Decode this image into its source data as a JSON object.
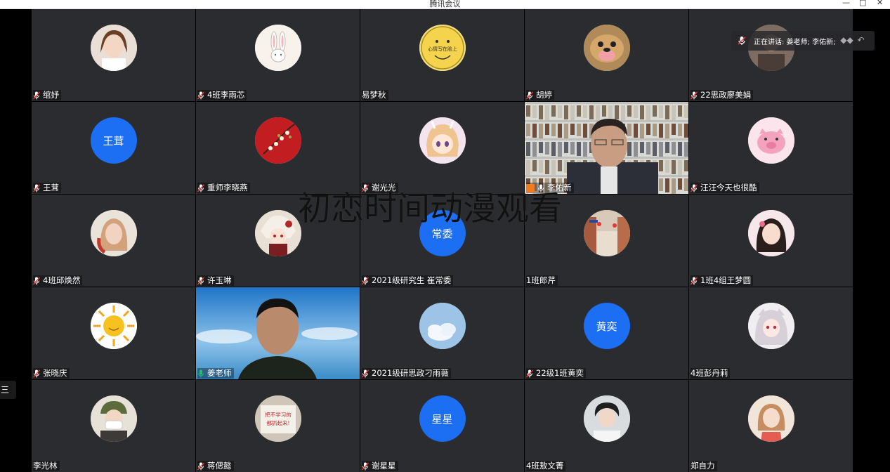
{
  "window": {
    "title": "腾讯会议",
    "min": "—",
    "max": "□",
    "close": "✕"
  },
  "speaking": {
    "text": "正在讲话: 姜老师; 李佑新;"
  },
  "watermark": "初恋时间动漫观看",
  "left_tab": "三",
  "accent": "#1c6ef3",
  "active_speaker_color": "#1fc16b",
  "tiles": [
    {
      "name": "绾妤",
      "mic": "muted",
      "avatar": "photo",
      "art": "girl"
    },
    {
      "name": "4班李雨芯",
      "mic": "muted",
      "avatar": "photo",
      "art": "rabbit"
    },
    {
      "name": "易梦秋",
      "mic": "none",
      "avatar": "photo",
      "art": "smiley",
      "art_text": "心情写在脸上"
    },
    {
      "name": "胡婷",
      "mic": "muted",
      "avatar": "photo",
      "art": "dog"
    },
    {
      "name": "22思政廖美娟",
      "mic": "muted",
      "avatar": "photo",
      "art": "hidden"
    },
    {
      "name": "王茸",
      "mic": "muted",
      "avatar": "text",
      "avatar_text": "王茸"
    },
    {
      "name": "重师李晓燕",
      "mic": "muted",
      "avatar": "photo",
      "art": "flowers"
    },
    {
      "name": "谢光光",
      "mic": "muted",
      "avatar": "photo",
      "art": "anime"
    },
    {
      "name": "李佑新",
      "mic": "speaking",
      "avatar": "video",
      "art": "bookshelf"
    },
    {
      "name": "汪汪今天也很酷",
      "mic": "muted",
      "avatar": "photo",
      "art": "pig"
    },
    {
      "name": "4班邱焕然",
      "mic": "muted",
      "avatar": "photo",
      "art": "girl2"
    },
    {
      "name": "许玉琳",
      "mic": "muted",
      "avatar": "photo",
      "art": "anime2"
    },
    {
      "name": "2021级研究生 崔常委",
      "mic": "muted",
      "avatar": "text",
      "avatar_text": "常委"
    },
    {
      "name": "1班郎芹",
      "mic": "none",
      "avatar": "photo",
      "art": "street"
    },
    {
      "name": "1班4组王梦圆",
      "mic": "muted",
      "avatar": "photo",
      "art": "girl3"
    },
    {
      "name": "张晓庆",
      "mic": "muted",
      "avatar": "photo",
      "art": "sun"
    },
    {
      "name": "姜老师",
      "mic": "active",
      "avatar": "video",
      "art": "sky"
    },
    {
      "name": "2021级研思政刁雨薇",
      "mic": "muted",
      "avatar": "photo",
      "art": "cloud"
    },
    {
      "name": "22级1班黄奕",
      "mic": "muted",
      "avatar": "text",
      "avatar_text": "黄奕"
    },
    {
      "name": "4班彭丹莉",
      "mic": "none",
      "avatar": "photo",
      "art": "anime3"
    },
    {
      "name": "李光林",
      "mic": "none",
      "avatar": "photo",
      "art": "mask"
    },
    {
      "name": "蒋偲懿",
      "mic": "muted",
      "avatar": "photo",
      "art": "sign",
      "art_text": "把不学习的都抓起来!"
    },
    {
      "name": "谢星星",
      "mic": "muted",
      "avatar": "text",
      "avatar_text": "星星"
    },
    {
      "name": "4班敖文菁",
      "mic": "none",
      "avatar": "photo",
      "art": "boy"
    },
    {
      "name": "郑自力",
      "mic": "none",
      "avatar": "photo",
      "art": "girl4"
    }
  ]
}
